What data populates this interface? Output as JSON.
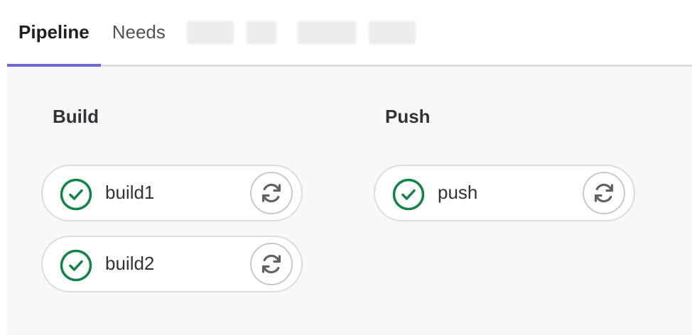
{
  "tabs": [
    {
      "label": "Pipeline",
      "active": true
    },
    {
      "label": "Needs",
      "active": false
    }
  ],
  "stages": [
    {
      "title": "Build",
      "jobs": [
        {
          "name": "build1",
          "status": "success"
        },
        {
          "name": "build2",
          "status": "success"
        }
      ]
    },
    {
      "title": "Push",
      "jobs": [
        {
          "name": "push",
          "status": "success"
        }
      ]
    }
  ],
  "colors": {
    "success": "#108548",
    "active_tab_indicator": "#6b6bd1",
    "retry_icon": "#626168",
    "job_border": "#dcdcde",
    "pipeline_background": "#f8f8f8"
  },
  "icons": {
    "status": "check-circle-icon",
    "retry": "retry-icon"
  }
}
